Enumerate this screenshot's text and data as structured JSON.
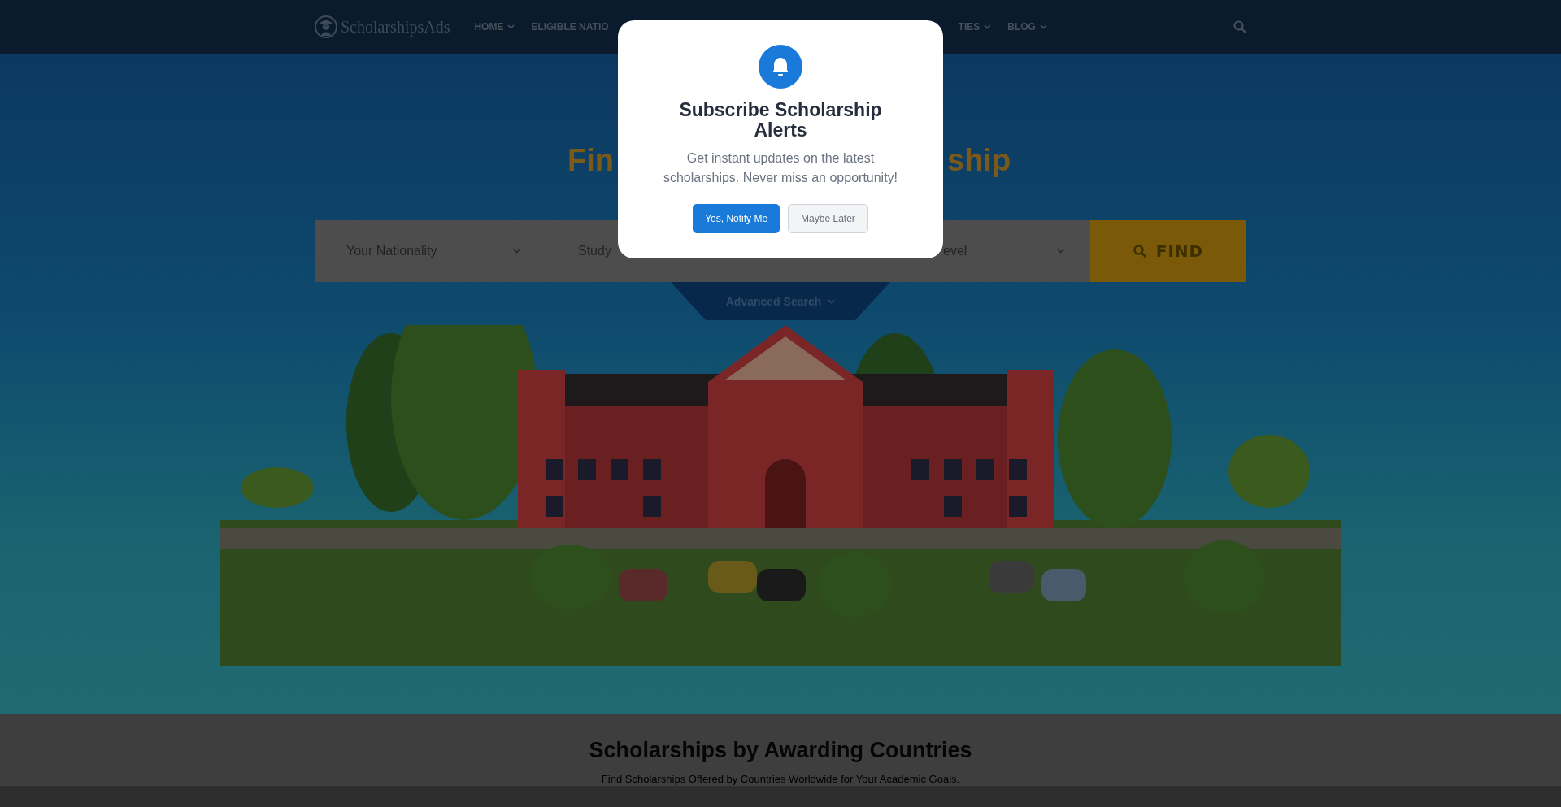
{
  "header": {
    "logo": "ScholarshipsAds",
    "nav": [
      {
        "label": "HOME",
        "dropdown": true
      },
      {
        "label": "ELIGIBLE NATIO",
        "dropdown": false
      },
      {
        "label": "TIES",
        "dropdown": true
      },
      {
        "label": "BLOG",
        "dropdown": true
      }
    ]
  },
  "hero": {
    "title_parts": [
      "Fin",
      "ship"
    ],
    "fields": [
      {
        "placeholder": "Your Nationality",
        "dropdown": true
      },
      {
        "placeholder": "Study",
        "dropdown": false
      },
      {
        "placeholder": "evel",
        "dropdown": true
      }
    ],
    "find_button": "FIND",
    "advanced_search": "Advanced Search"
  },
  "section": {
    "title": "Scholarships by Awarding Countries",
    "subtitle": "Find Scholarships Offered by Countries Worldwide for Your Academic Goals."
  },
  "modal": {
    "title": "Subscribe Scholarship Alerts",
    "message": "Get instant updates on the latest scholarships. Never miss an opportunity!",
    "buttons": [
      {
        "label": "Yes, Notify Me",
        "kind": "primary"
      },
      {
        "label": "Maybe Later",
        "kind": "secondary"
      }
    ]
  }
}
